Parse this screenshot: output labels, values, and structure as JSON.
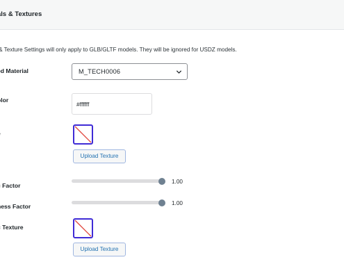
{
  "header": {
    "title": "als & Textures"
  },
  "notice": "l & Texture Settings will only apply to GLB/GLTF models. They will be ignored for USDZ models.",
  "fields": {
    "material_label": "ed Material",
    "material_value": "M_TECH0006",
    "color_label": "olor",
    "color_value": "#ffffff",
    "texture_label": "e",
    "metallic_label": "c Factor",
    "metallic_value": "1.00",
    "metallic_level": 1.0,
    "roughness_label": "ness Factor",
    "roughness_value": "1.00",
    "roughness_level": 1.0,
    "metallic_texture_label": "c Texture",
    "upload_label": "Upload Texture"
  },
  "colors": {
    "accent": "#3f2bd6",
    "button_text": "#2271b1",
    "thumb": "#6f8191"
  },
  "icons": {
    "select": "chevron-down-icon",
    "texture": "empty-texture-icon"
  }
}
